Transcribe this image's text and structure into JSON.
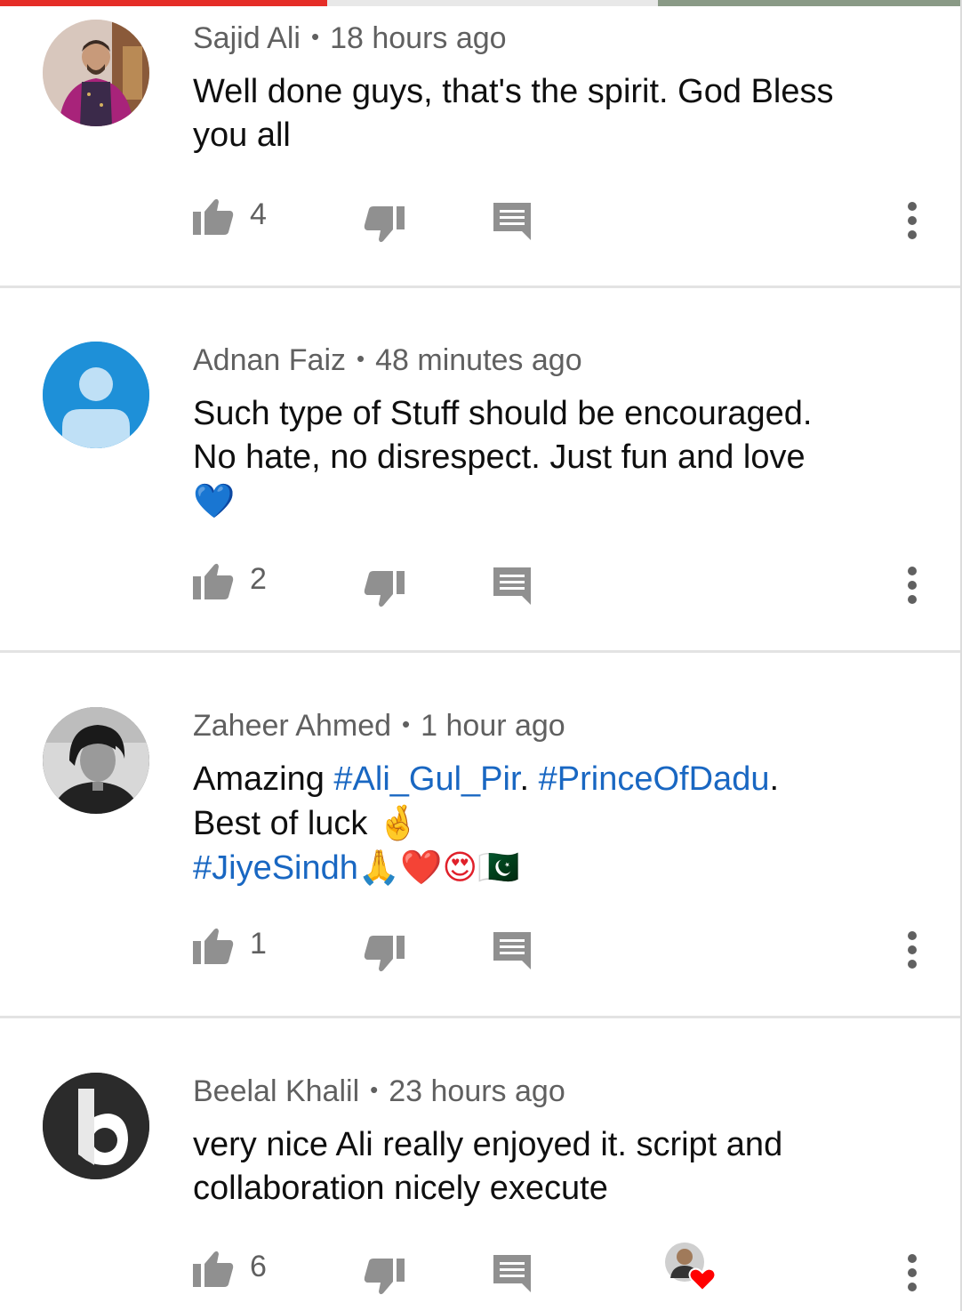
{
  "video_progress": 0.34,
  "colors": {
    "progress": "#e52d27",
    "meta_text": "#606060",
    "body_text": "#0f0f0f",
    "hashtag": "#1967c2",
    "icon": "#909090",
    "divider": "#e3e3e3",
    "default_avatar_bg": "#1e90d8"
  },
  "comments": [
    {
      "author": "Sajid Ali",
      "separator": "•",
      "time": "18 hours ago",
      "text_lines": [
        "Well done guys, that's the spirit. God Bless",
        "you all"
      ],
      "likes": "4",
      "avatar_icon": "photo-avatar-man-red-shirt"
    },
    {
      "author": "Adnan Faiz",
      "separator": "•",
      "time": "48 minutes ago",
      "text_lines": [
        "Such type of Stuff should be encouraged.",
        "No hate, no disrespect. Just fun and love"
      ],
      "emoji_line": "💙",
      "likes": "2",
      "avatar_icon": "default-person-avatar"
    },
    {
      "author": "Zaheer Ahmed",
      "separator": "•",
      "time": "1 hour ago",
      "text_prefix": "Amazing ",
      "hashtag1": "#Ali_Gul_Pir",
      "text_mid": ". ",
      "hashtag2": "#PrinceOfDadu",
      "text_end": ".",
      "line2": "Best of luck ",
      "line2_emoji": "🤞",
      "hashtag3": "#JiyeSindh",
      "line3_emoji": "🙏❤️😍🇵🇰",
      "likes": "1",
      "avatar_icon": "photo-avatar-black-white"
    },
    {
      "author": "Beelal Khalil",
      "separator": "•",
      "time": "23 hours ago",
      "text_lines": [
        "very nice Ali really enjoyed it. script and",
        "collaboration nicely execute"
      ],
      "likes": "6",
      "avatar_icon": "b-logo-avatar",
      "creator_heart": "creator-heart-badge"
    }
  ]
}
